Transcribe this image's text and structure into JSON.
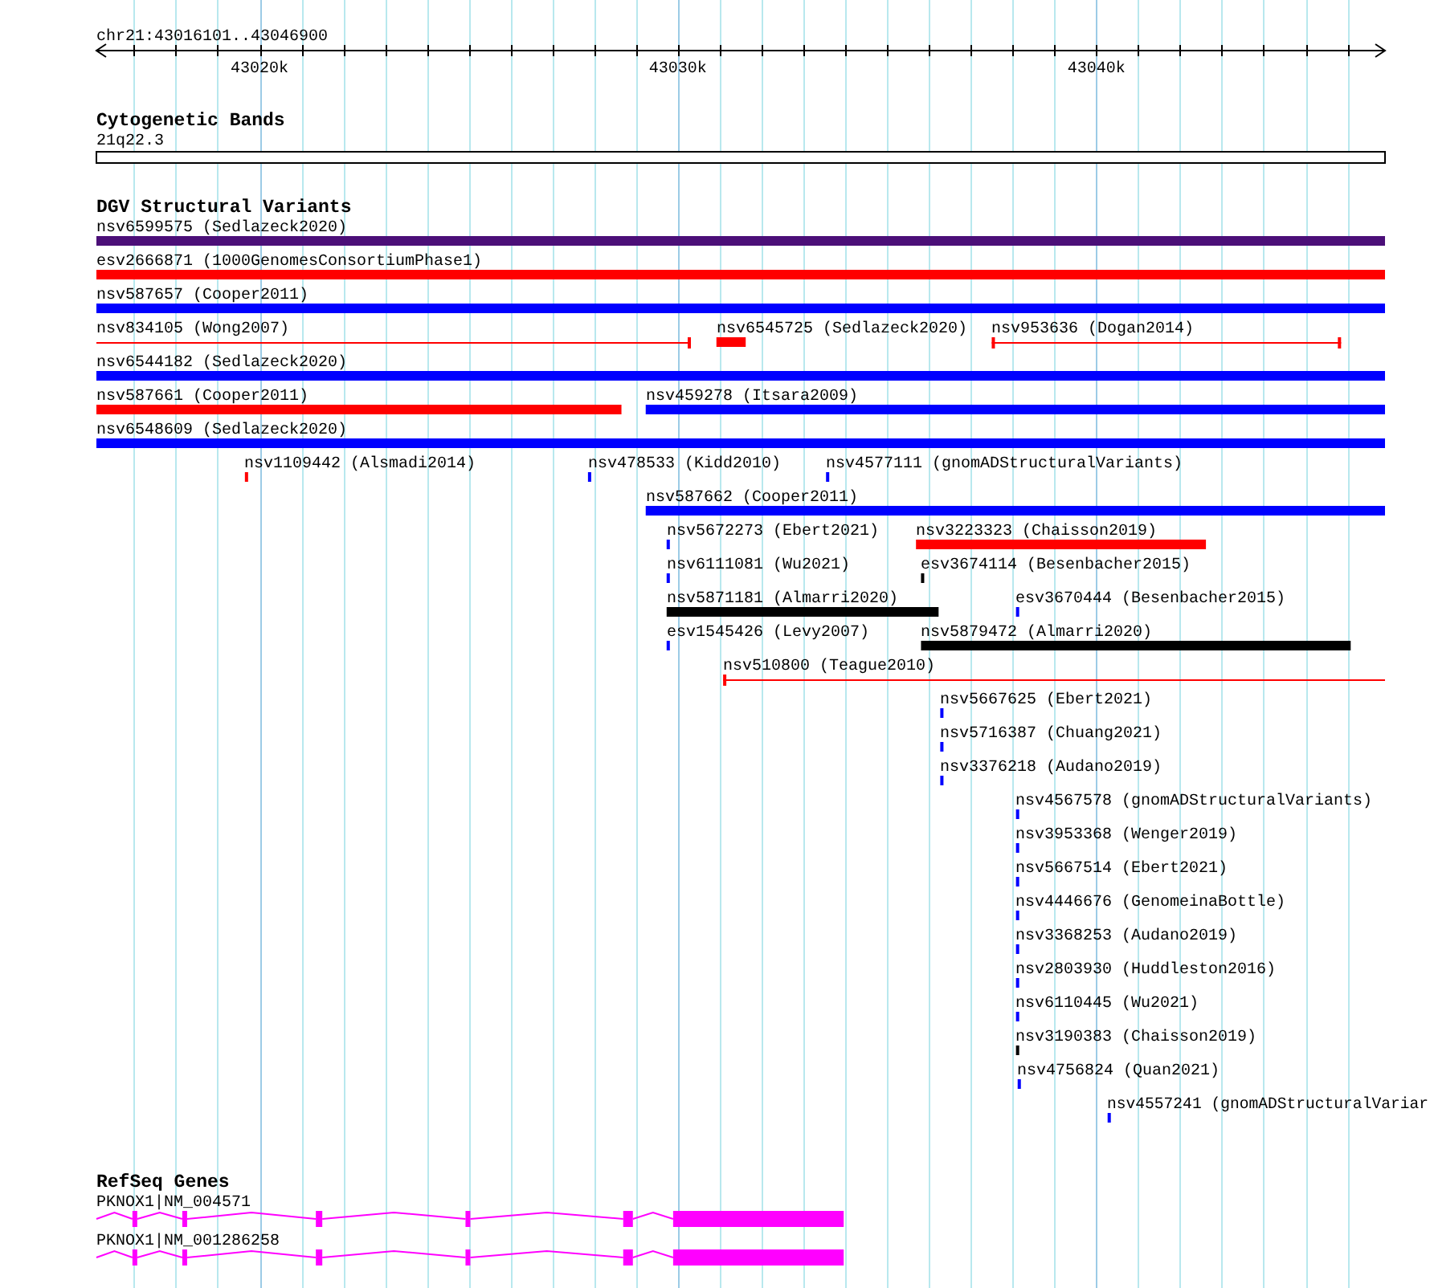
{
  "ruler": {
    "label": "chr21:43016101..43046900",
    "ticks": [
      {
        "label": "43020k"
      },
      {
        "label": "43030k"
      },
      {
        "label": "43040k"
      }
    ]
  },
  "tracks": [
    {
      "kind": "cytoband",
      "title": "Cytogenetic Bands",
      "bands": [
        {
          "label": "21q22.3"
        }
      ]
    },
    {
      "kind": "variants",
      "title": "DGV Structural Variants",
      "rows": [
        {
          "features": [
            {
              "label": "nsv6599575 (Sedlazeck2020)",
              "kind": "bar",
              "color": "#4b0f78"
            }
          ]
        },
        {
          "features": [
            {
              "label": "esv2666871 (1000GenomesConsortiumPhase1)",
              "kind": "bar",
              "color": "#ff0000"
            }
          ]
        },
        {
          "features": [
            {
              "label": "nsv587657 (Cooper2011)",
              "kind": "bar",
              "color": "#0000ff"
            }
          ]
        },
        {
          "features": [
            {
              "label": "nsv834105 (Wong2007)",
              "kind": "line",
              "color": "#ff0000"
            },
            {
              "label": "nsv6545725 (Sedlazeck2020)",
              "kind": "bar",
              "color": "#ff0000"
            },
            {
              "label": "nsv953636 (Dogan2014)",
              "kind": "line",
              "color": "#ff0000"
            }
          ]
        },
        {
          "features": [
            {
              "label": "nsv6544182 (Sedlazeck2020)",
              "kind": "bar",
              "color": "#0000ff"
            }
          ]
        },
        {
          "features": [
            {
              "label": "nsv587661 (Cooper2011)",
              "kind": "bar",
              "color": "#ff0000"
            },
            {
              "label": "nsv459278 (Itsara2009)",
              "kind": "bar",
              "color": "#0000ff"
            }
          ]
        },
        {
          "features": [
            {
              "label": "nsv6548609 (Sedlazeck2020)",
              "kind": "bar",
              "color": "#0000ff"
            }
          ]
        },
        {
          "features": [
            {
              "label": "nsv1109442 (Alsmadi2014)",
              "kind": "bar",
              "color": "#ff0000"
            },
            {
              "label": "nsv478533 (Kidd2010)",
              "kind": "bar",
              "color": "#0000ff"
            },
            {
              "label": "nsv4577111 (gnomADStructuralVariants)",
              "kind": "bar",
              "color": "#0000ff"
            }
          ]
        },
        {
          "features": [
            {
              "label": "nsv587662 (Cooper2011)",
              "kind": "bar",
              "color": "#0000ff"
            }
          ]
        },
        {
          "features": [
            {
              "label": "nsv5672273 (Ebert2021)",
              "kind": "bar",
              "color": "#0000ff"
            },
            {
              "label": "nsv3223323 (Chaisson2019)",
              "kind": "bar",
              "color": "#ff0000"
            }
          ]
        },
        {
          "features": [
            {
              "label": "nsv6111081 (Wu2021)",
              "kind": "bar",
              "color": "#0000ff"
            },
            {
              "label": "esv3674114 (Besenbacher2015)",
              "kind": "bar",
              "color": "#000000"
            }
          ]
        },
        {
          "features": [
            {
              "label": "nsv5871181 (Almarri2020)",
              "kind": "bar",
              "color": "#000000"
            },
            {
              "label": "esv3670444 (Besenbacher2015)",
              "kind": "bar",
              "color": "#0000ff"
            }
          ]
        },
        {
          "features": [
            {
              "label": "esv1545426 (Levy2007)",
              "kind": "bar",
              "color": "#0000ff"
            },
            {
              "label": "nsv5879472 (Almarri2020)",
              "kind": "bar",
              "color": "#000000"
            }
          ]
        },
        {
          "features": [
            {
              "label": "nsv510800 (Teague2010)",
              "kind": "line",
              "color": "#ff0000"
            }
          ]
        },
        {
          "features": [
            {
              "label": "nsv5667625 (Ebert2021)",
              "kind": "bar",
              "color": "#0000ff"
            }
          ]
        },
        {
          "features": [
            {
              "label": "nsv5716387 (Chuang2021)",
              "kind": "bar",
              "color": "#0000ff"
            }
          ]
        },
        {
          "features": [
            {
              "label": "nsv3376218 (Audano2019)",
              "kind": "bar",
              "color": "#0000ff"
            }
          ]
        },
        {
          "features": [
            {
              "label": "nsv4567578 (gnomADStructuralVariants)",
              "kind": "bar",
              "color": "#0000ff"
            }
          ]
        },
        {
          "features": [
            {
              "label": "nsv3953368 (Wenger2019)",
              "kind": "bar",
              "color": "#0000ff"
            }
          ]
        },
        {
          "features": [
            {
              "label": "nsv5667514 (Ebert2021)",
              "kind": "bar",
              "color": "#0000ff"
            }
          ]
        },
        {
          "features": [
            {
              "label": "nsv4446676 (GenomeinaBottle)",
              "kind": "bar",
              "color": "#0000ff"
            }
          ]
        },
        {
          "features": [
            {
              "label": "nsv3368253 (Audano2019)",
              "kind": "bar",
              "color": "#0000ff"
            }
          ]
        },
        {
          "features": [
            {
              "label": "nsv2803930 (Huddleston2016)",
              "kind": "bar",
              "color": "#0000ff"
            }
          ]
        },
        {
          "features": [
            {
              "label": "nsv6110445 (Wu2021)",
              "kind": "bar",
              "color": "#0000ff"
            }
          ]
        },
        {
          "features": [
            {
              "label": "nsv3190383 (Chaisson2019)",
              "kind": "bar",
              "color": "#000000"
            }
          ]
        },
        {
          "features": [
            {
              "label": "nsv4756824 (Quan2021)",
              "kind": "bar",
              "color": "#0000ff"
            }
          ]
        },
        {
          "features": [
            {
              "label": "nsv4557241 (gnomADStructuralVariar",
              "kind": "bar",
              "color": "#0000ff"
            }
          ]
        }
      ]
    },
    {
      "kind": "genes",
      "title": "RefSeq Genes",
      "genes": [
        {
          "label": "PKNOX1|NM_004571"
        },
        {
          "label": "PKNOX1|NM_001286258"
        }
      ]
    }
  ]
}
